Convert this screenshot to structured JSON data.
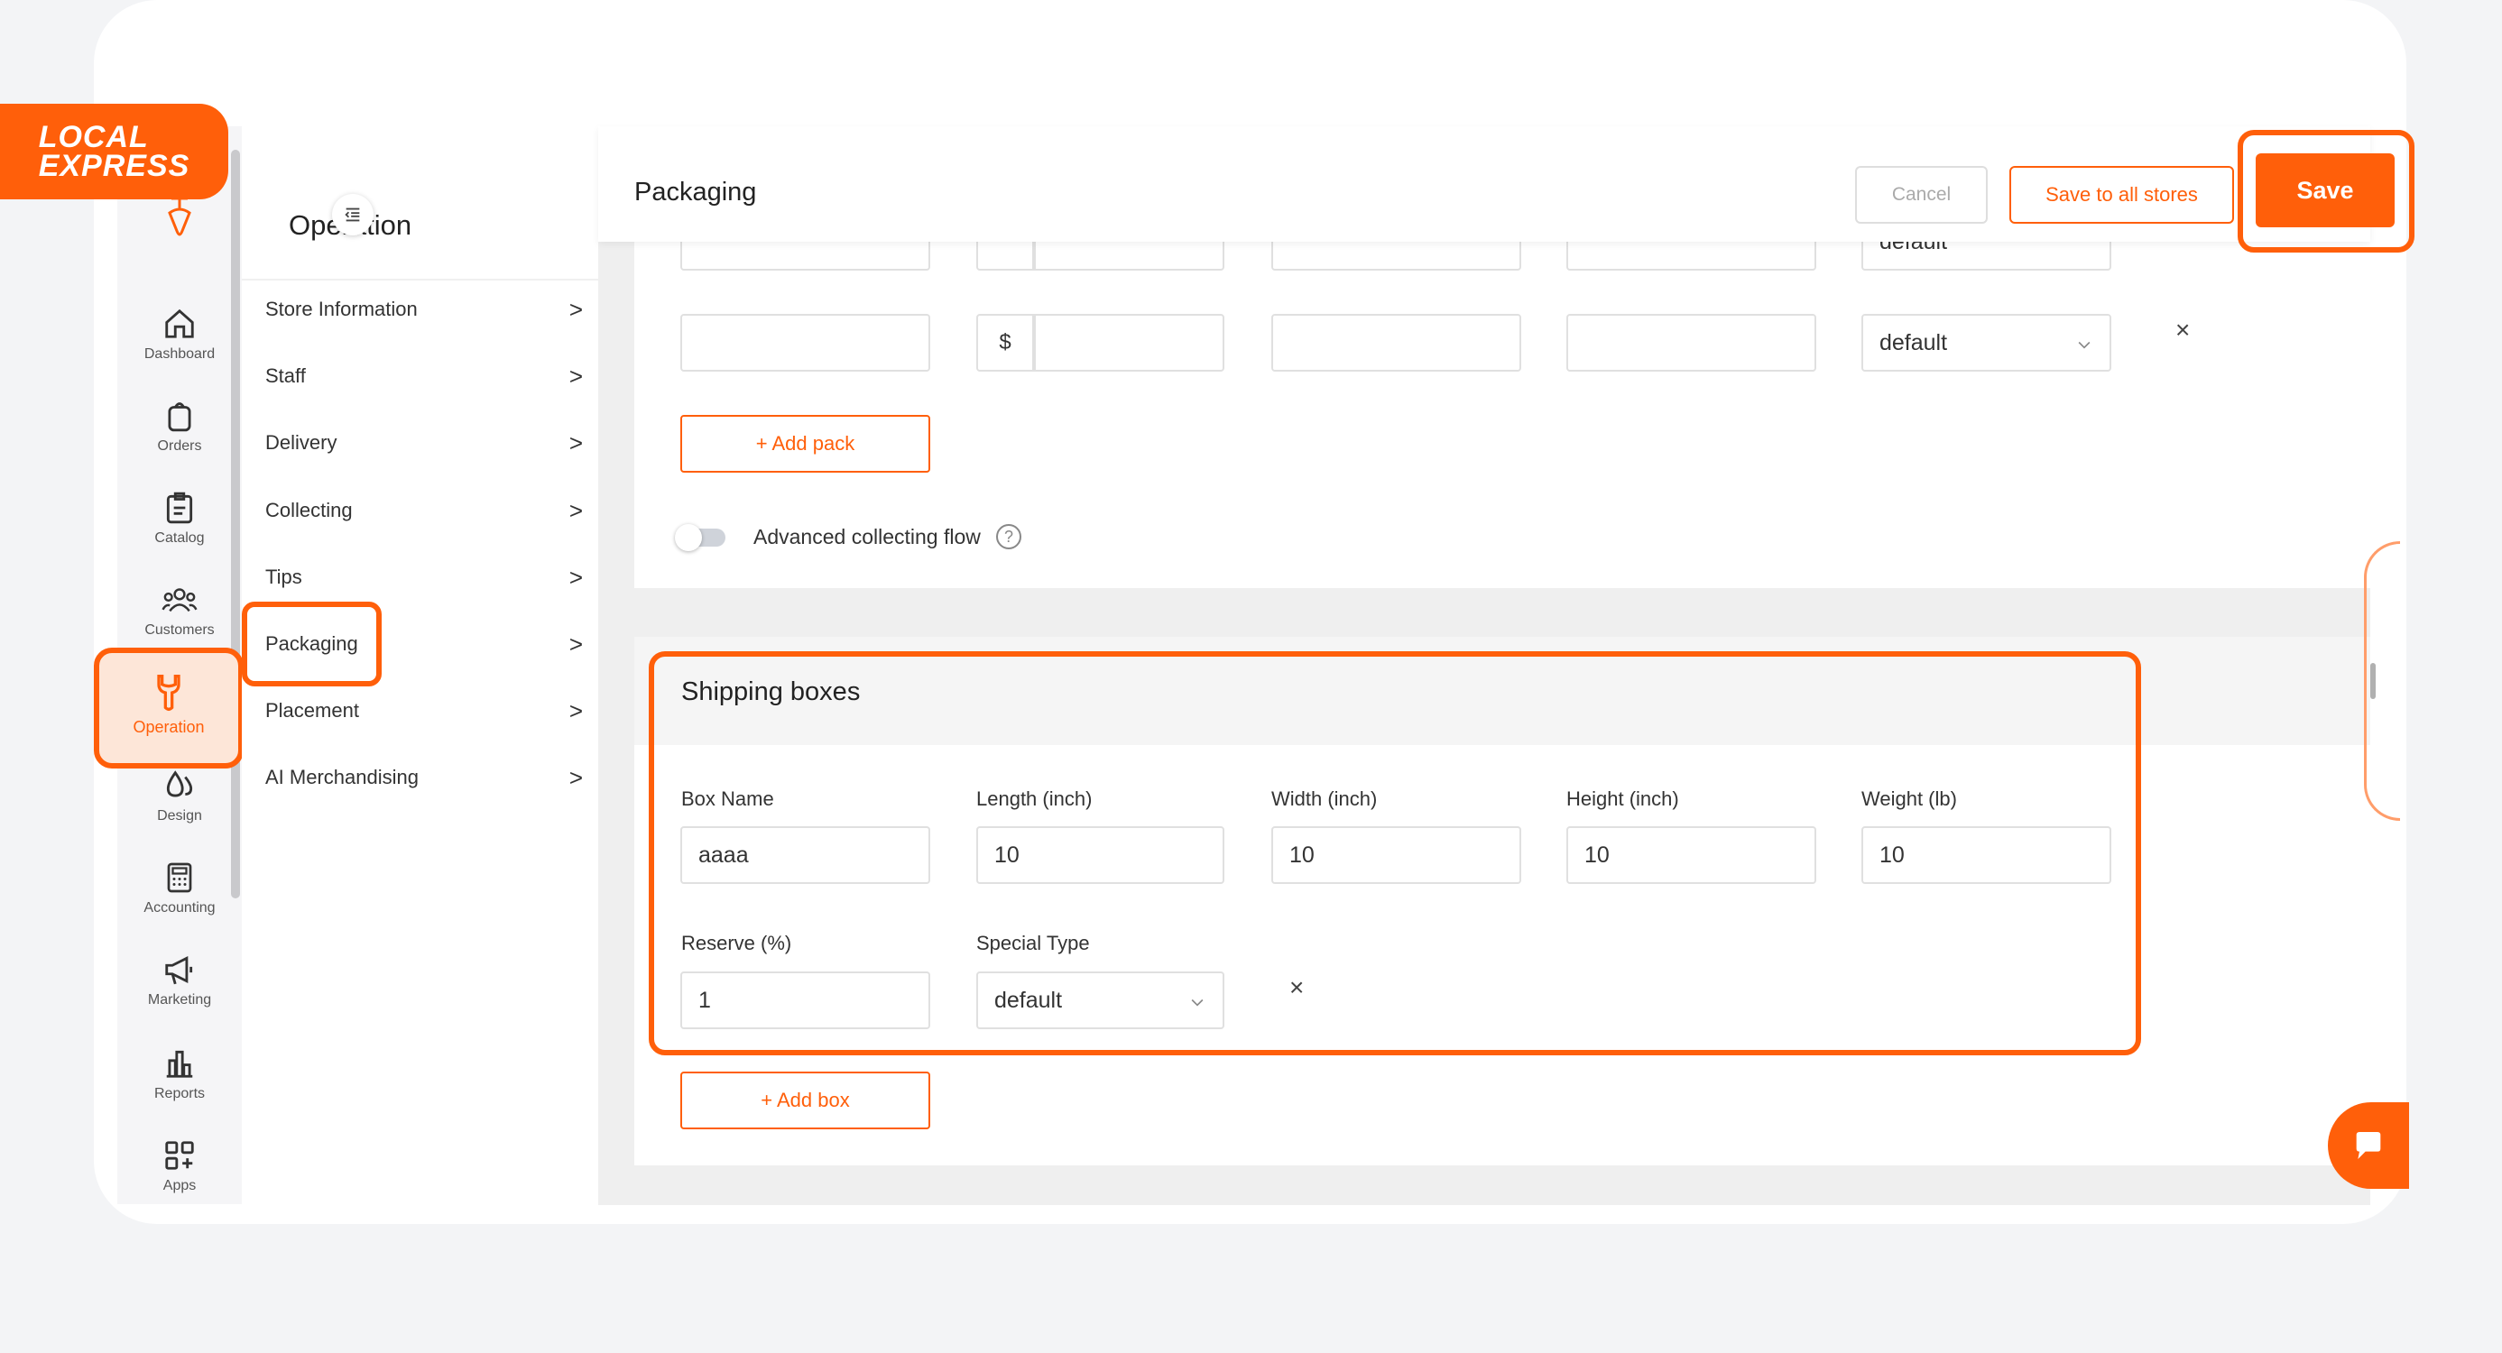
{
  "brand": {
    "logo_line1": "LOCAL",
    "logo_line2": "EXPRESS",
    "accent": "#ff5f0a"
  },
  "rail": [
    {
      "label": "Dashboard",
      "icon": "home-icon"
    },
    {
      "label": "Orders",
      "icon": "bag-icon"
    },
    {
      "label": "Catalog",
      "icon": "clipboard-icon"
    },
    {
      "label": "Customers",
      "icon": "users-icon"
    },
    {
      "label": "Operation",
      "icon": "wrench-icon",
      "active": true
    },
    {
      "label": "Design",
      "icon": "drops-icon"
    },
    {
      "label": "Accounting",
      "icon": "calculator-icon"
    },
    {
      "label": "Marketing",
      "icon": "megaphone-icon"
    },
    {
      "label": "Reports",
      "icon": "bar-chart-icon"
    },
    {
      "label": "Apps",
      "icon": "apps-grid-icon"
    }
  ],
  "menu": {
    "title": "Operation",
    "items": [
      {
        "label": "Store Information"
      },
      {
        "label": "Staff"
      },
      {
        "label": "Delivery"
      },
      {
        "label": "Collecting"
      },
      {
        "label": "Tips"
      },
      {
        "label": "Packaging",
        "active": true
      },
      {
        "label": "Placement"
      },
      {
        "label": "AI Merchandising"
      }
    ],
    "chevron": ">"
  },
  "header": {
    "title": "Packaging",
    "cancel": "Cancel",
    "save_all": "Save to all stores",
    "save": "Save"
  },
  "packs": {
    "partial_row_select": "default",
    "row": {
      "currency": "$",
      "select": "default"
    },
    "add_pack": "+ Add pack",
    "advanced_label": "Advanced collecting flow",
    "advanced_enabled": false,
    "help": "?"
  },
  "shipping": {
    "title": "Shipping boxes",
    "labels": {
      "box_name": "Box Name",
      "length": "Length (inch)",
      "width": "Width (inch)",
      "height": "Height (inch)",
      "weight": "Weight (lb)",
      "reserve": "Reserve (%)",
      "special_type": "Special Type"
    },
    "values": {
      "box_name": "aaaa",
      "length": "10",
      "width": "10",
      "height": "10",
      "weight": "10",
      "reserve": "1",
      "special_type": "default"
    },
    "add_box": "+ Add box",
    "remove": "×"
  }
}
